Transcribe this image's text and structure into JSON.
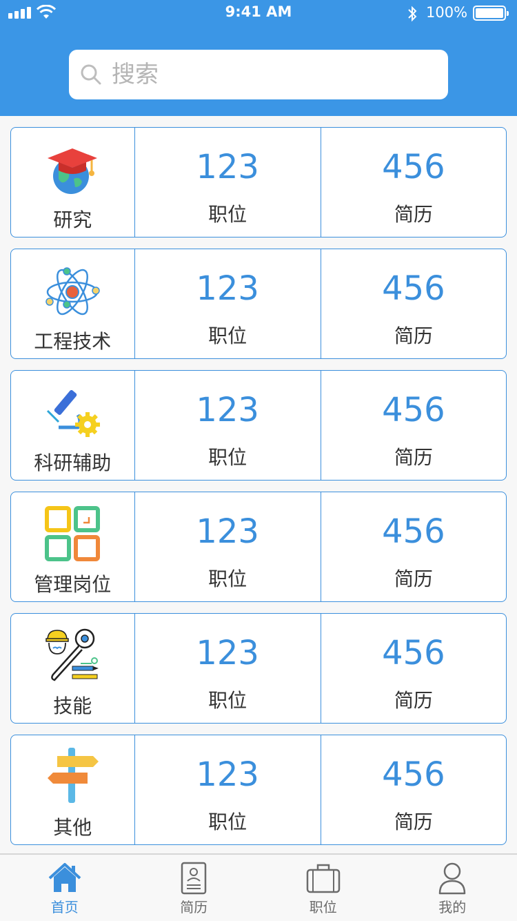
{
  "status_bar": {
    "time": "9:41 AM",
    "battery": "100%"
  },
  "search": {
    "placeholder": "搜索"
  },
  "categories": [
    {
      "label": "研究",
      "icon": "graduation-globe-icon",
      "positions_count": "123",
      "positions_label": "职位",
      "resumes_count": "456",
      "resumes_label": "简历"
    },
    {
      "label": "工程技术",
      "icon": "atom-icon",
      "positions_count": "123",
      "positions_label": "职位",
      "resumes_count": "456",
      "resumes_label": "简历"
    },
    {
      "label": "科研辅助",
      "icon": "microscope-gear-icon",
      "positions_count": "123",
      "positions_label": "职位",
      "resumes_count": "456",
      "resumes_label": "简历"
    },
    {
      "label": "管理岗位",
      "icon": "grid-squares-icon",
      "positions_count": "123",
      "positions_label": "职位",
      "resumes_count": "456",
      "resumes_label": "简历"
    },
    {
      "label": "技能",
      "icon": "worker-tools-icon",
      "positions_count": "123",
      "positions_label": "职位",
      "resumes_count": "456",
      "resumes_label": "简历"
    },
    {
      "label": "其他",
      "icon": "signpost-icon",
      "positions_count": "123",
      "positions_label": "职位",
      "resumes_count": "456",
      "resumes_label": "简历"
    }
  ],
  "tabbar": {
    "items": [
      {
        "label": "首页",
        "icon": "home-icon",
        "active": true
      },
      {
        "label": "简历",
        "icon": "resume-icon",
        "active": false
      },
      {
        "label": "职位",
        "icon": "briefcase-icon",
        "active": false
      },
      {
        "label": "我的",
        "icon": "user-icon",
        "active": false
      }
    ]
  },
  "colors": {
    "header": "#3b96e6",
    "accent": "#3b8fdc"
  }
}
